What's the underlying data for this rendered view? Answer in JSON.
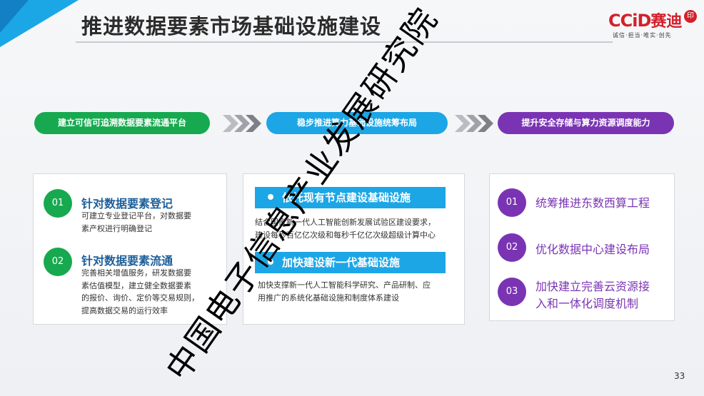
{
  "header": {
    "title": "推进数据要素市场基础设施建设"
  },
  "logo": {
    "mark": "CCiD",
    "name": "赛迪",
    "slogan": "诚信·担当·唯实·创先",
    "seal": "印"
  },
  "pills": [
    {
      "label": "建立可信可追溯数据要素流通平台",
      "color": "#17a94f"
    },
    {
      "label": "稳步推进算力基础设施统筹布局",
      "color": "#1ca6e6"
    },
    {
      "label": "提升安全存储与算力资源调度能力",
      "color": "#7a34b3"
    }
  ],
  "card1": {
    "items": [
      {
        "num": "01",
        "title": "针对数据要素登记",
        "lines": [
          "可建立专业登记平台，对数据要",
          "素产权进行明确登记"
        ]
      },
      {
        "num": "02",
        "title": "针对数据要素流通",
        "lines": [
          "完善相关增值服务，研发数据要",
          "素估值模型，建立健全数据要素",
          "的报价、询价、定价等交易规则，",
          "提高数据交易的运行效率"
        ]
      }
    ]
  },
  "card2": {
    "sections": [
      {
        "title": "依托现有节点建设基础设施",
        "lines": [
          "结合国家新一代人工智能创新发展试验区建设要求，",
          "建设每秒百亿亿次级和每秒千亿亿次级超级计算中心"
        ]
      },
      {
        "title": "加快建设新一代基础设施",
        "lines": [
          "加快支撑新一代人工智能科学研究、产品研制、应",
          "用推广的系统化基础设施和制度体系建设"
        ]
      }
    ]
  },
  "card3": {
    "items": [
      {
        "num": "01",
        "lines": [
          "统筹推进东数西算工程"
        ]
      },
      {
        "num": "02",
        "lines": [
          "优化数据中心建设布局"
        ]
      },
      {
        "num": "03",
        "lines": [
          "加快建立完善云资源接",
          "入和一体化调度机制"
        ]
      }
    ]
  },
  "watermark": "中国电子信息产业发展研究院",
  "page_number": "33"
}
